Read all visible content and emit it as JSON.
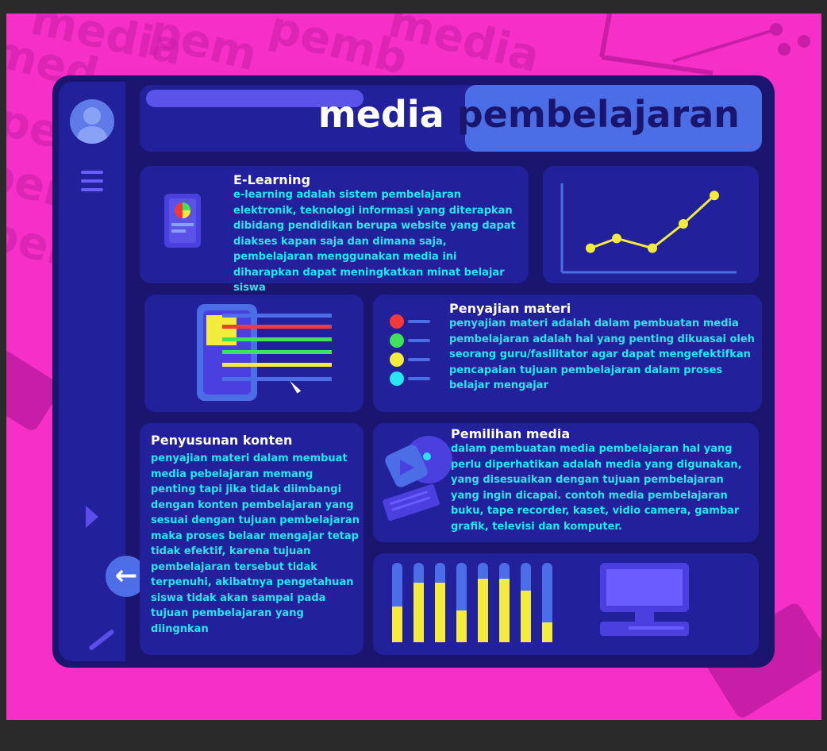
{
  "header": {
    "title_word1": "media",
    "title_word2": "pembelajaran"
  },
  "background_watermark": [
    "media",
    "pem",
    "pemb",
    "media",
    "pemb",
    "pem",
    "med",
    "pe"
  ],
  "sidebar": {
    "back_icon": "arrow-left-icon",
    "items": [
      "avatar-icon",
      "menu-icon",
      "play-icon",
      "pen-icon"
    ]
  },
  "cards": {
    "elearning": {
      "title": "E-Learning",
      "body": "e-learning adalah sistem pembelajaran elektronik, teknologi informasi yang diterapkan dibidang pendidikan berupa website yang dapat diakses kapan saja dan dimana saja, pembelajaran menggunakan media ini diharapkan dapat meningkatkan minat belajar siswa"
    },
    "penyajian": {
      "title": "Penyajian materi",
      "body": "penyajian materi adalah dalam pembuatan media pembelajaran adalah hal yang penting dikuasai oleh seorang guru/fasilitator agar dapat mengefektifkan pencapaian tujuan pembelajaran dalam proses belajar mengajar"
    },
    "penyusunan": {
      "title": "Penyusunan konten",
      "body": "penyajian materi dalam membuat media pebelajaran memang penting tapi jika tidak diimbangi dengan konten pembelajaran yang sesuai dengan tujuan pembelajaran maka proses belaar mengajar tetap tidak efektif, karena tujuan pembelajaran tersebut tidak terpenuhi, akibatnya pengetahuan siswa tidak akan sampai pada tujuan pembelajaran yang diingnkan"
    },
    "pemilihan": {
      "title": "Pemilihan media",
      "body": "dalam pembuatan media pembelajaran hal yang perlu diperhatikan adalah media yang digunakan, yang disesuaikan dengan tujuan pembelajaran yang ingin dicapai. contoh media pembelajaran buku, tape recorder, kaset, vidio camera, gambar grafik, televisi dan komputer."
    }
  },
  "colors": {
    "background": "#f52fc8",
    "frame": "#1a1670",
    "panel": "#22209a",
    "accent": "#4b6ee6",
    "text": "#27e6f2",
    "yellow": "#f4ec3c"
  },
  "decor": {
    "line_chart_levels": [
      0.2,
      0.32,
      0.2,
      0.5,
      0.85
    ],
    "list_dot_colors": [
      "#f23a3a",
      "#3ee35b",
      "#f4ec3c",
      "#27e6f2"
    ],
    "bar_levels": [
      0.45,
      0.75,
      0.75,
      0.4,
      0.8,
      0.8,
      0.65,
      0.25
    ]
  }
}
